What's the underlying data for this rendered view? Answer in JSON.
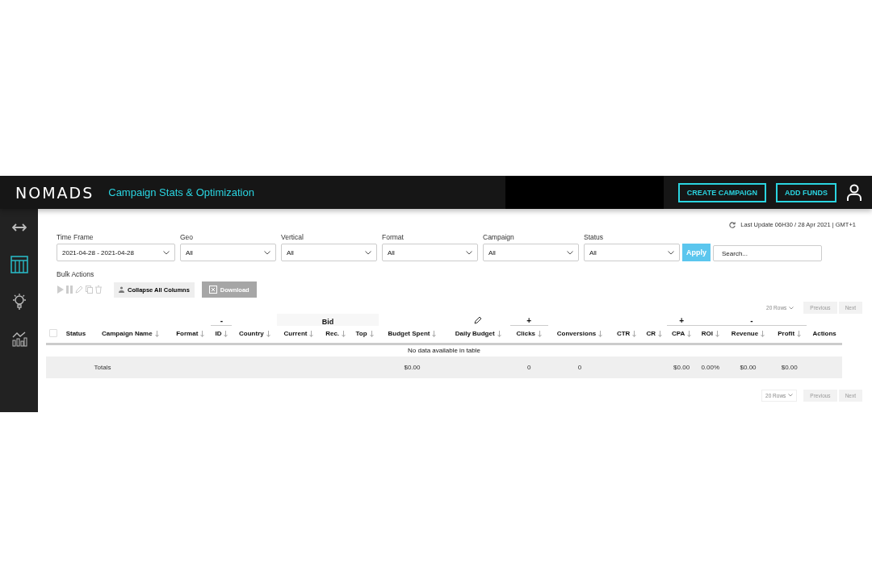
{
  "header": {
    "logo": "NOMADS",
    "title": "Campaign Stats & Optimization",
    "buttons": [
      "CREATE CAMPAIGN",
      "ADD FUNDS"
    ]
  },
  "sidebar": {
    "items": [
      {
        "kind": "expand",
        "selected": false
      },
      {
        "kind": "table",
        "selected": true
      },
      {
        "kind": "bulb",
        "selected": false
      },
      {
        "kind": "chart",
        "selected": false
      }
    ]
  },
  "last_update": "Last Update 06H30 / 28 Apr 2021 | GMT+1",
  "filters": [
    {
      "label": "Time Frame",
      "value": "2021-04-28 - 2021-04-28"
    },
    {
      "label": "Geo",
      "value": "All"
    },
    {
      "label": "Vertical",
      "value": "All"
    },
    {
      "label": "Format",
      "value": "All"
    },
    {
      "label": "Campaign",
      "value": "All"
    },
    {
      "label": "Status",
      "value": "All"
    }
  ],
  "apply_button": "Apply",
  "search": {
    "placeholder": "Search..."
  },
  "bulk_actions": {
    "label": "Bulk Actions",
    "collapse_button": "Collapse All Columns",
    "download_button": {
      "label": "Download",
      "disabled": true
    }
  },
  "pagination_top": {
    "rows": "20 Rows",
    "previous": "Previous",
    "next": "Next"
  },
  "table": {
    "header": [
      {
        "kind": "checkbox",
        "checked": false
      },
      {
        "kind": "column",
        "label": "Status",
        "sortable": false
      },
      {
        "kind": "column",
        "label": "Campaign Name",
        "sortable": true,
        "total": "Totals"
      },
      {
        "kind": "column",
        "label": "Format",
        "sortable": true
      },
      {
        "kind": "column",
        "label": "ID",
        "sortable": true,
        "marker": "-"
      },
      {
        "kind": "column",
        "label": "Country",
        "sortable": true
      },
      {
        "kind": "group",
        "label": "Bid",
        "columns": [
          {
            "label": "Current",
            "sortable": true
          },
          {
            "label": "Rec.",
            "sortable": true
          },
          {
            "label": "Top",
            "sortable": true
          }
        ]
      },
      {
        "kind": "column",
        "label": "Budget Spent",
        "sortable": true,
        "total": "$0.00"
      },
      {
        "kind": "column",
        "label": "Daily Budget",
        "sortable": true,
        "editable": true
      },
      {
        "kind": "column",
        "label": "Clicks",
        "sortable": true,
        "marker": "+",
        "total": "0"
      },
      {
        "kind": "column",
        "label": "Conversions",
        "sortable": true,
        "total": "0"
      },
      {
        "kind": "column",
        "label": "CTR",
        "sortable": true
      },
      {
        "kind": "column",
        "label": "CR",
        "sortable": true
      },
      {
        "kind": "column",
        "label": "CPA",
        "sortable": true,
        "marker": "+",
        "total": "$0.00"
      },
      {
        "kind": "group",
        "label": "-",
        "columns": [
          {
            "label": "ROI",
            "sortable": true,
            "total": "0.00%"
          },
          {
            "label": "Revenue",
            "sortable": true,
            "total": "$0.00"
          },
          {
            "label": "Profit",
            "sortable": true,
            "total": "$0.00"
          }
        ]
      },
      {
        "kind": "column",
        "label": "Actions",
        "sortable": false
      }
    ],
    "empty_message": "No data available in table"
  },
  "pagination_bottom": {
    "rows": "20 Rows",
    "previous": "Previous",
    "next": "Next"
  }
}
